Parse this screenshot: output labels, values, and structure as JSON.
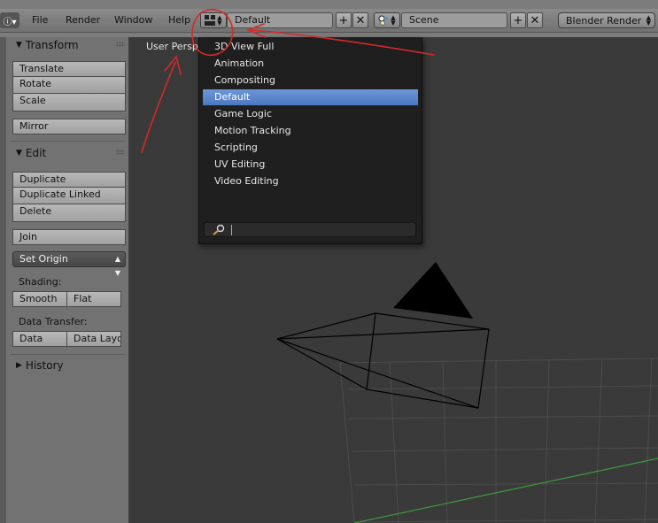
{
  "header": {
    "menus": [
      "File",
      "Render",
      "Window",
      "Help"
    ],
    "screen_layout": "Default",
    "scene": "Scene",
    "render_engine": "Blender Render"
  },
  "toolshelf": {
    "transform": {
      "title": "Transform",
      "buttons": [
        "Translate",
        "Rotate",
        "Scale"
      ],
      "mirror": "Mirror"
    },
    "edit": {
      "title": "Edit",
      "buttons": [
        "Duplicate",
        "Duplicate Linked",
        "Delete"
      ],
      "join": "Join",
      "set_origin": "Set Origin",
      "shading_label": "Shading:",
      "shading_buttons": [
        "Smooth",
        "Flat"
      ],
      "data_transfer_label": "Data Transfer:",
      "data_transfer_buttons": [
        "Data",
        "Data Layo"
      ]
    },
    "history": {
      "title": "History"
    }
  },
  "viewport": {
    "label": "User Persp"
  },
  "layout_menu": {
    "items": [
      "3D View Full",
      "Animation",
      "Compositing",
      "Default",
      "Game Logic",
      "Motion Tracking",
      "Scripting",
      "UV Editing",
      "Video Editing"
    ],
    "selected": "Default"
  },
  "colors": {
    "selected_highlight": "#5b87cc",
    "annotation": "#d42a2a",
    "viewport_bg": "#3a3a3a",
    "grid": "#4c4c4c",
    "x_axis": "#3d9a3d"
  }
}
